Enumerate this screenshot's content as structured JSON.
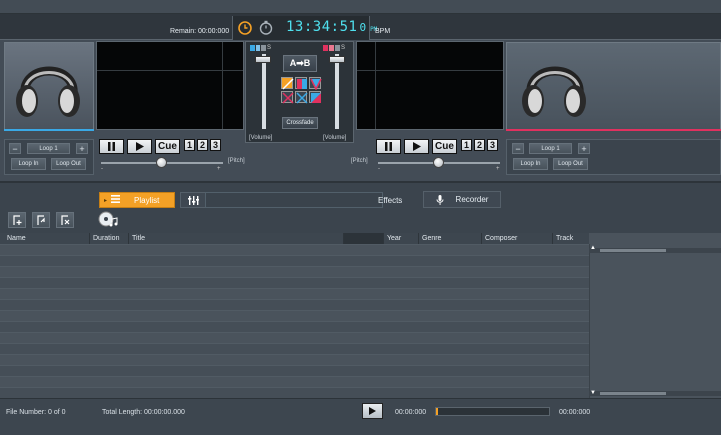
{
  "header": {
    "remain_label": "Remain: 00:00:000",
    "clock_time": "13:34:51",
    "clock_digit": "0",
    "clock_ampm": "PM",
    "bpm_label": "BPM"
  },
  "mixer": {
    "volume_left": "[Volume]",
    "volume_right": "[Volume]",
    "ab_label": "A➡B",
    "crossfade_label": "Crossfade",
    "meter_s": "S"
  },
  "deck_left": {
    "loop_label": "Loop 1",
    "minus": "−",
    "plus": "+",
    "loop_in": "Loop In",
    "loop_out": "Loop Out",
    "cue": "Cue",
    "hot1": "1",
    "hot2": "2",
    "hot3": "3",
    "pitch_label": "[Pitch]",
    "pitch_minus": "-",
    "pitch_plus": "+"
  },
  "deck_right": {
    "loop_label": "Loop 1",
    "minus": "−",
    "plus": "+",
    "loop_in": "Loop In",
    "loop_out": "Loop Out",
    "cue": "Cue",
    "hot1": "1",
    "hot2": "2",
    "hot3": "3",
    "pitch_label": "[Pitch]",
    "pitch_minus": "-",
    "pitch_plus": "+"
  },
  "tabs": {
    "playlist": "Playlist",
    "effects": "Effects",
    "recorder": "Recorder"
  },
  "columns": {
    "name": "Name",
    "duration": "Duration",
    "title": "Title",
    "year": "Year",
    "genre": "Genre",
    "composer": "Composer",
    "track": "Track"
  },
  "footer": {
    "file_number": "File Number: 0 of 0",
    "total_length": "Total Length: 00:00:00.000",
    "time_start": "00:00:000",
    "time_end": "00:00:000"
  },
  "colors": {
    "accent_orange": "#f4a126",
    "clock_cyan": "#4fe0ee",
    "deck_left_line": "#3aa9e6",
    "deck_right_line": "#e0315f"
  }
}
